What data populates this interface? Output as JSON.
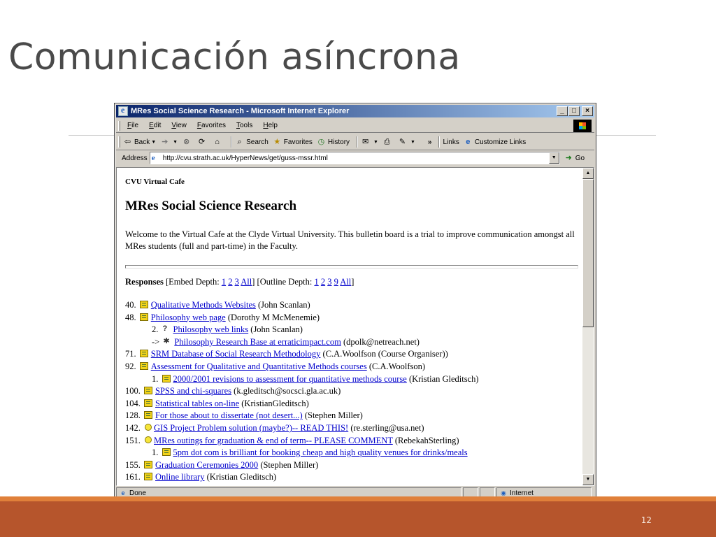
{
  "slide": {
    "title": "Comunicación asíncrona",
    "number": "12",
    "colors": {
      "accent_stripe": "#e0803a",
      "footer": "#b6552c",
      "title": "#4a4a4a"
    }
  },
  "window": {
    "title": "MRes Social Science Research - Microsoft Internet Explorer",
    "controls": {
      "minimize": "_",
      "maximize": "□",
      "close": "×"
    }
  },
  "menu": [
    "File",
    "Edit",
    "View",
    "Favorites",
    "Tools",
    "Help"
  ],
  "toolbar": {
    "back": "Back",
    "search": "Search",
    "favorites": "Favorites",
    "history": "History",
    "chevron": "»",
    "links": "Links",
    "customize_links": "Customize Links"
  },
  "address": {
    "label": "Address",
    "url": "http://cvu.strath.ac.uk/HyperNews/get/guss-mssr.html",
    "go": "Go"
  },
  "page": {
    "site": "CVU Virtual Cafe",
    "heading": "MRes Social Science Research",
    "welcome": "Welcome to the Virtual Cafe at the Clyde Virtual University. This bulletin board is a trial to improve communication amongst all MRes students (full and part-time) in the Faculty.",
    "responses": {
      "label": "Responses",
      "embed_prefix": "[Embed Depth:",
      "embed_links": [
        "1",
        "2",
        "3",
        "All"
      ],
      "outline_prefix": "] [Outline Depth:",
      "outline_links": [
        "1",
        "2",
        "3",
        "9",
        "All"
      ],
      "suffix": "]"
    },
    "items": [
      {
        "num": "40.",
        "icon": "note",
        "title": "Qualitative Methods Websites",
        "author": "(John Scanlan)",
        "indent": false
      },
      {
        "num": "48.",
        "icon": "note",
        "title": "Philosophy web page",
        "author": "(Dorothy M McMenemie)",
        "indent": false
      },
      {
        "num": "2.",
        "icon": "question",
        "title": "Philosophy web links",
        "author": "(John Scanlan)",
        "indent": true
      },
      {
        "num": "->",
        "icon": "web",
        "title": "Philosophy Research Base at erraticimpact.com",
        "author": "(dpolk@netreach.net)",
        "indent": true
      },
      {
        "num": "71.",
        "icon": "note",
        "title": "SRM Database of Social Research Methodology",
        "author": "(C.A.Woolfson (Course Organiser))",
        "indent": false
      },
      {
        "num": "92.",
        "icon": "note",
        "title": "Assessment for Qualitative and Quantitative Methods courses",
        "author": "(C.A.Woolfson)",
        "indent": false
      },
      {
        "num": "1.",
        "icon": "note",
        "title": "2000/2001 revisions to assessment for quantitative methods course",
        "author": "(Kristian Gleditsch)",
        "indent": true
      },
      {
        "num": "100.",
        "icon": "note",
        "title": "SPSS and chi-squares",
        "author": "(k.gleditsch@socsci.gla.ac.uk)",
        "indent": false
      },
      {
        "num": "104.",
        "icon": "note",
        "title": "Statistical tables on-line",
        "author": "(KristianGleditsch)",
        "indent": false
      },
      {
        "num": "128.",
        "icon": "note",
        "title": "For those about to dissertate (not desert...)",
        "author": "(Stephen Miller)",
        "indent": false
      },
      {
        "num": "142.",
        "icon": "bulb",
        "title": "GIS Project Problem solution (maybe?)-- READ THIS!",
        "author": "(re.sterling@usa.net)",
        "indent": false
      },
      {
        "num": "151.",
        "icon": "bulb",
        "title": "MRes outings for graduation & end of term-- PLEASE COMMENT",
        "author": "(RebekahSterling)",
        "indent": false
      },
      {
        "num": "1.",
        "icon": "note",
        "title": "5pm dot com is brilliant for booking cheap and high quality venues for drinks/meals",
        "author": "",
        "indent": true
      },
      {
        "num": "155.",
        "icon": "note",
        "title": "Graduation Ceremonies 2000",
        "author": "(Stephen Miller)",
        "indent": false
      },
      {
        "num": "161.",
        "icon": "note",
        "title": "Online library",
        "author": "(Kristian Gleditsch)",
        "indent": false
      }
    ]
  },
  "status": {
    "text": "Done",
    "zone": "Internet"
  }
}
